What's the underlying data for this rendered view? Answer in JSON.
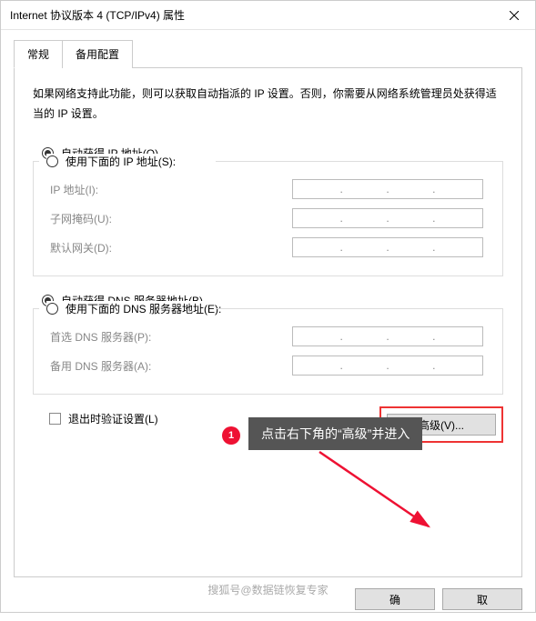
{
  "window": {
    "title": "Internet 协议版本 4 (TCP/IPv4) 属性"
  },
  "tabs": {
    "general": "常规",
    "alternate": "备用配置"
  },
  "description": "如果网络支持此功能，则可以获取自动指派的 IP 设置。否则，你需要从网络系统管理员处获得适当的 IP 设置。",
  "ip_section": {
    "auto": "自动获得 IP 地址(O)",
    "manual": "使用下面的 IP 地址(S):",
    "ip_label": "IP 地址(I):",
    "subnet_label": "子网掩码(U):",
    "gateway_label": "默认网关(D):"
  },
  "dns_section": {
    "auto": "自动获得 DNS 服务器地址(B)",
    "manual": "使用下面的 DNS 服务器地址(E):",
    "preferred_label": "首选 DNS 服务器(P):",
    "alternate_label": "备用 DNS 服务器(A):"
  },
  "validate_checkbox": "退出时验证设置(L)",
  "advanced_button": "高级(V)...",
  "footer": {
    "ok": "确",
    "cancel": "取"
  },
  "callout": {
    "number": "1",
    "text": "点击右下角的“高级”并进入"
  },
  "watermark": "搜狐号@数据链恢复专家"
}
